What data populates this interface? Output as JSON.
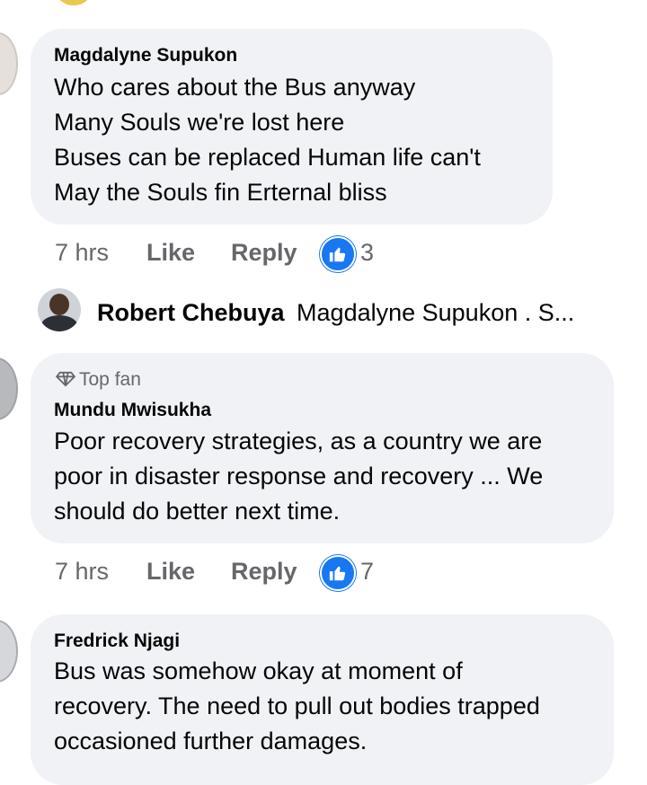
{
  "comments": [
    {
      "author": "Magdalyne Supukon",
      "text": "Who cares about the Bus anyway\nMany Souls we're  lost here\nBuses can be replaced Human life can't\nMay the Souls fin Erternal bliss",
      "time": "7 hrs",
      "like_label": "Like",
      "reply_label": "Reply",
      "reaction_count": "3"
    },
    {
      "badge": "Top fan",
      "author": "Mundu Mwisukha",
      "text": "Poor recovery strategies, as a country we are\npoor in disaster response and recovery ... We\nshould do better next time.",
      "time": "7 hrs",
      "like_label": "Like",
      "reply_label": "Reply",
      "reaction_count": "7"
    },
    {
      "author": "Fredrick Njagi",
      "text": "Bus was somehow okay at moment of\nrecovery. The need to pull out bodies trapped\noccasioned further damages."
    }
  ],
  "reply_preview": {
    "author": "Robert Chebuya",
    "text": "Magdalyne Supukon . S..."
  },
  "colors": {
    "bubble": "#f0f2f5",
    "meta_text": "#65676b",
    "like_blue": "#1877f2"
  },
  "icons": {
    "reaction": "thumbs-up-icon",
    "badge": "diamond-icon"
  }
}
